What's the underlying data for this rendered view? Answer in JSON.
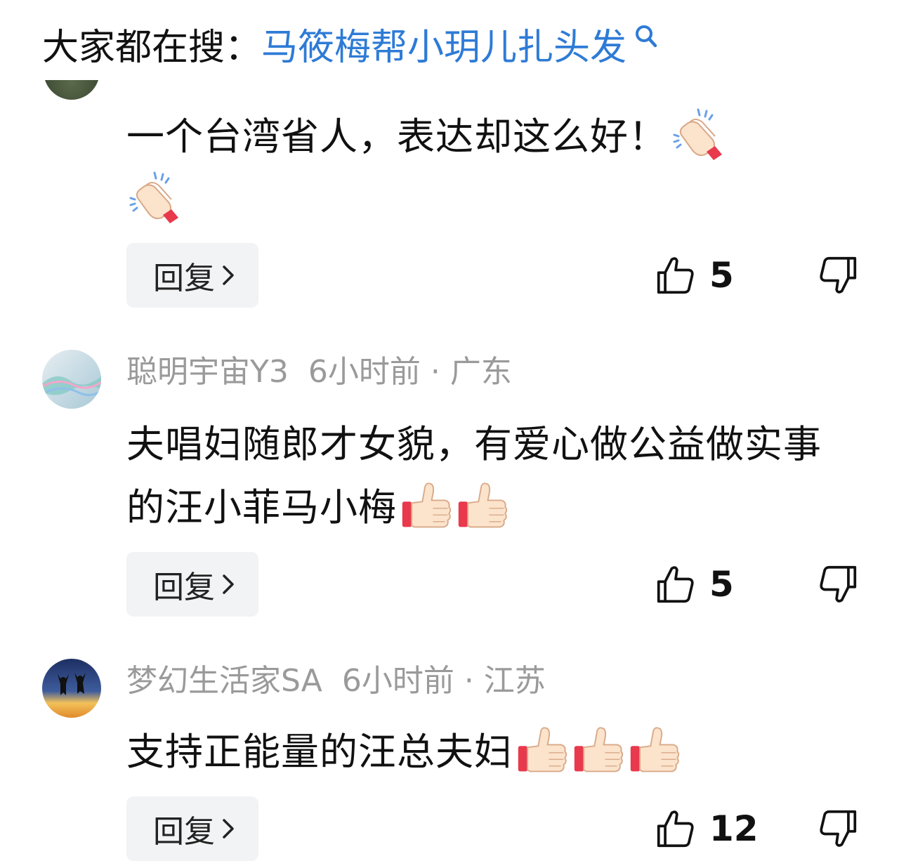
{
  "search": {
    "prefix": "大家都在搜：",
    "term": "马筱梅帮小玥儿扎头发",
    "icon": "search-icon"
  },
  "colors": {
    "link_blue": "#2e7bd6",
    "meta_gray": "#9a9a9a",
    "reply_bg": "#f2f3f5"
  },
  "comments": [
    {
      "text": "一个台湾省人，表达却这么好！",
      "emoji": [
        "clapping-hands-icon",
        "clapping-hands-icon"
      ],
      "reply_label": "回复",
      "likes": "5"
    },
    {
      "author": "聪明宇宙Y3",
      "meta": "6小时前 · 广东",
      "text": "夫唱妇随郎才女貌，有爱心做公益做实事的汪小菲马小梅",
      "emoji": [
        "thumbs-up-icon",
        "thumbs-up-icon"
      ],
      "reply_label": "回复",
      "likes": "5"
    },
    {
      "author": "梦幻生活家SA",
      "meta": "6小时前 · 江苏",
      "text": "支持正能量的汪总夫妇",
      "emoji": [
        "thumbs-up-icon",
        "thumbs-up-icon",
        "thumbs-up-icon"
      ],
      "reply_label": "回复",
      "likes": "12"
    }
  ]
}
